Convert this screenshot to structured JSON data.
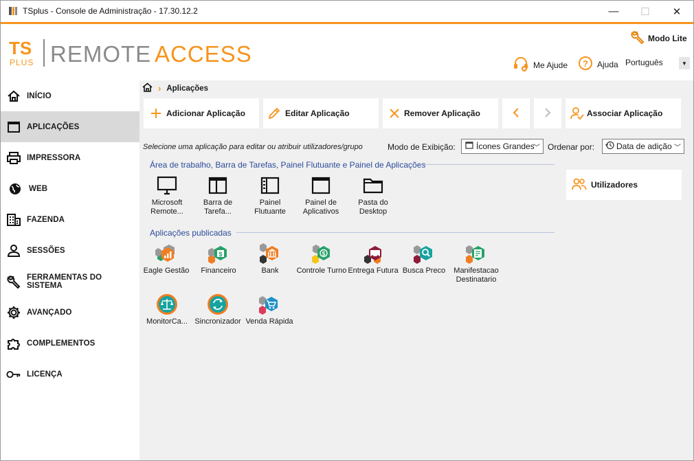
{
  "window": {
    "title": "TSplus - Console de Administração - 17.30.12.2",
    "minimize_glyph": "—",
    "maximize_glyph": "☐",
    "close_glyph": "✕"
  },
  "brand": {
    "ts": "TS",
    "plus": "PLUS",
    "remote": "REMOTE",
    "access": "ACCESS",
    "orange": "#f7941d",
    "grey": "#8a8a8a"
  },
  "header": {
    "modo_lite": "Modo Lite",
    "me_ajude": "Me Ajude",
    "ajuda": "Ajuda",
    "language": "Português"
  },
  "sidebar": {
    "items": [
      {
        "label": "INÍCIO",
        "icon": "home-icon"
      },
      {
        "label": "APLICAÇÕES",
        "icon": "window-icon",
        "active": true
      },
      {
        "label": "IMPRESSORA",
        "icon": "printer-icon"
      },
      {
        "label": "WEB",
        "icon": "globe-icon"
      },
      {
        "label": "FAZENDA",
        "icon": "building-icon"
      },
      {
        "label": "SESSÕES",
        "icon": "user-icon"
      },
      {
        "label": "FERRAMENTAS DO SISTEMA",
        "icon": "wrench-icon"
      },
      {
        "label": "AVANÇADO",
        "icon": "gear-icon"
      },
      {
        "label": "COMPLEMENTOS",
        "icon": "puzzle-icon"
      },
      {
        "label": "LICENÇA",
        "icon": "key-icon"
      }
    ]
  },
  "breadcrumb": {
    "current": "Aplicações"
  },
  "toolbar": {
    "add": "Adicionar Aplicação",
    "edit": "Editar Aplicação",
    "remove": "Remover Aplicação",
    "assign": "Associar Aplicação"
  },
  "controls": {
    "hint": "Selecione uma aplicação para editar ou atribuir utilizadores/grupo",
    "view_mode_label": "Modo de Exibição:",
    "view_mode_value": "Ícones Grandes",
    "sort_label": "Ordenar por:",
    "sort_value": "Data de adição"
  },
  "groups": {
    "desktop_title": "Área de trabalho, Barra de Tarefas, Painel Flutuante e Painel de Aplicações",
    "published_title": "Aplicações publicadas"
  },
  "desktop_apps": [
    {
      "label": "Microsoft Remote...",
      "icon": "monitor-icon"
    },
    {
      "label": "Barra de Tarefa...",
      "icon": "taskbar-icon"
    },
    {
      "label": "Painel Flutuante",
      "icon": "floating-panel-icon"
    },
    {
      "label": "Painel de Aplicativos",
      "icon": "app-panel-icon"
    },
    {
      "label": "Pasta do Desktop",
      "icon": "folder-icon"
    }
  ],
  "published_apps": [
    {
      "label": "Eagle Gestão",
      "icon": "chart-hex-icon",
      "color": "#f07d22"
    },
    {
      "label": "Financeiro",
      "icon": "money-hex-icon",
      "color": "#26a269"
    },
    {
      "label": "Bank",
      "icon": "bank-hex-icon",
      "color": "#f07d22"
    },
    {
      "label": "Controle Turno",
      "icon": "dollar-hex-icon",
      "color": "#26a269"
    },
    {
      "label": "Entrega Futura",
      "icon": "truck-hex-icon",
      "color": "#8e1b3a"
    },
    {
      "label": "Busca Preco",
      "icon": "search-hex-icon",
      "color": "#16a3a0"
    },
    {
      "label": "Manifestacao Destinatario",
      "icon": "doc-hex-icon",
      "color": "#26a269"
    },
    {
      "label": "MonitorCa...",
      "icon": "scale-circle-icon",
      "color": "#f07d22"
    },
    {
      "label": "Sincronizador",
      "icon": "sync-circle-icon",
      "color": "#16a3a0"
    },
    {
      "label": "Venda Rápida",
      "icon": "cart-hex-icon",
      "color": "#1e90c8"
    }
  ],
  "users_panel": {
    "label": "Utilizadores"
  }
}
